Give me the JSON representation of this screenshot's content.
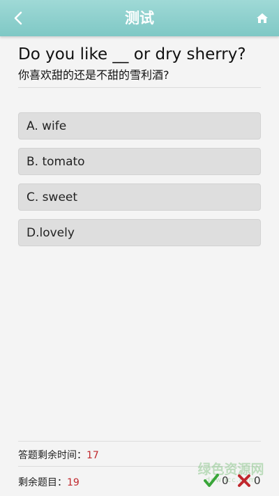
{
  "header": {
    "title": "测试",
    "back_icon": "chevron-left-icon",
    "home_icon": "home-icon",
    "bg_color": "#8fd0cd"
  },
  "question": {
    "english": "Do you like __ or dry sherry?",
    "chinese": "你喜欢甜的还是不甜的雪利酒?"
  },
  "options": [
    {
      "label": "A. wife"
    },
    {
      "label": "B. tomato"
    },
    {
      "label": "C. sweet"
    },
    {
      "label": "D.lovely"
    }
  ],
  "footer": {
    "time_label": "答题剩余时间：",
    "time_value": "17",
    "remaining_label": "剩余题目：",
    "remaining_value": "19",
    "correct_count": "0",
    "wrong_count": "0",
    "correct_icon": "check-icon",
    "wrong_icon": "cross-icon",
    "accent_red": "#c0282d",
    "accent_green": "#3aa63a"
  },
  "watermark": {
    "text": "绿色资源网",
    "sub": "downcc.com"
  }
}
